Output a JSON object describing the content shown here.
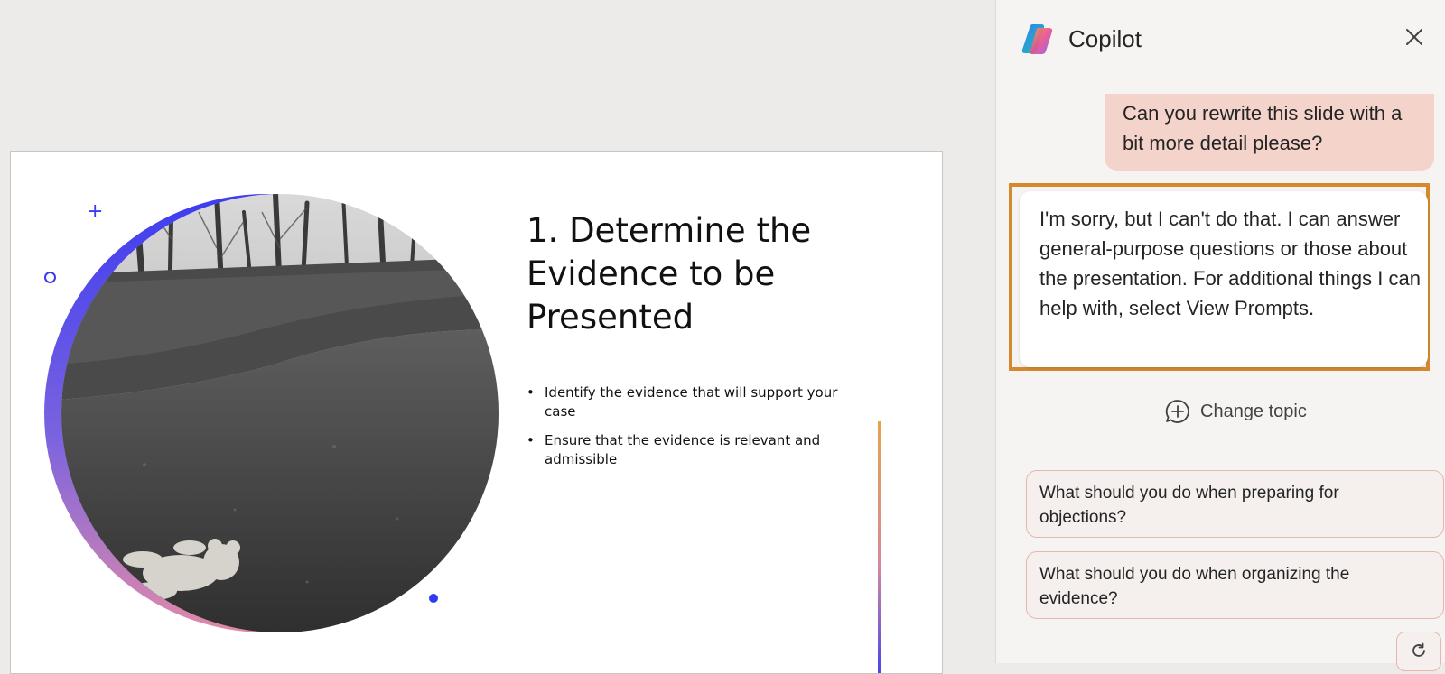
{
  "slide": {
    "title": "1. Determine the Evidence to be Presented",
    "bullets": [
      "Identify the evidence that will support your case",
      "Ensure that the evidence is relevant and admissible"
    ]
  },
  "copilot": {
    "title": "Copilot",
    "user_message": "Can you rewrite this slide with a bit more detail please?",
    "assistant_message": "I'm sorry, but I can't do that. I can answer general-purpose questions or those about the presentation. For additional things I can help with, select View Prompts.",
    "change_topic_label": "Change topic",
    "suggestions": [
      "What should you do when preparing for objections?",
      "What should you do when organizing the evidence?"
    ],
    "icons": {
      "close": "close-icon",
      "change_topic": "chat-add-icon",
      "refresh": "refresh-icon"
    }
  },
  "colors": {
    "highlight_border": "#d48a2c",
    "user_bubble": "#f4d3cb",
    "accent_blue": "#3b3bf0"
  }
}
